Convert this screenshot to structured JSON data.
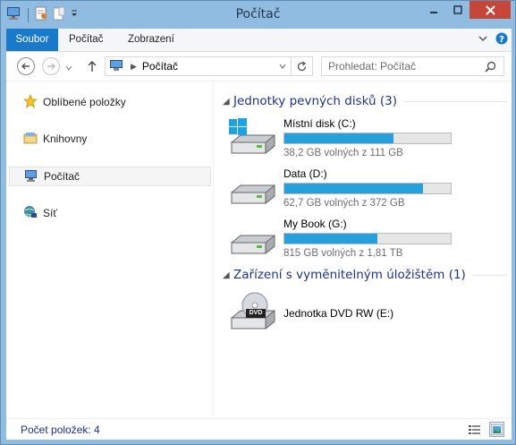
{
  "window": {
    "title": "Počítač"
  },
  "ribbon": {
    "tabs": [
      {
        "label": "Soubor",
        "active": true
      },
      {
        "label": "Počítač",
        "active": false
      },
      {
        "label": "Zobrazení",
        "active": false
      }
    ]
  },
  "address": {
    "path": "Počítač"
  },
  "search": {
    "placeholder": "Prohledat: Počítač"
  },
  "nav": {
    "items": [
      {
        "label": "Oblíbené položky",
        "icon": "star-icon"
      },
      {
        "label": "Knihovny",
        "icon": "library-icon"
      },
      {
        "label": "Počítač",
        "icon": "computer-icon",
        "selected": true
      },
      {
        "label": "Síť",
        "icon": "network-icon"
      }
    ]
  },
  "groups": {
    "hard_drives": {
      "title": "Jednotky pevných disků (3)",
      "drives": [
        {
          "name": "Místní disk (C:)",
          "free": "38,2 GB volných z 111 GB",
          "used_fraction": 0.656,
          "windows": true
        },
        {
          "name": "Data (D:)",
          "free": "62,7 GB volných z 372 GB",
          "used_fraction": 0.831,
          "windows": false
        },
        {
          "name": "My Book (G:)",
          "free": "815 GB volných z 1,81 TB",
          "used_fraction": 0.56,
          "windows": false
        }
      ]
    },
    "removable": {
      "title": "Zařízení s vyměnitelným úložištěm (1)",
      "devices": [
        {
          "name": "Jednotka DVD RW (E:)",
          "icon": "dvd-drive-icon",
          "badge": "DVD"
        }
      ]
    }
  },
  "status": {
    "item_count": "Počet položek: 4"
  },
  "colors": {
    "accent": "#1979ca",
    "bar_fill": "#26a0da",
    "close": "#c7463a",
    "group_title": "#1e3287"
  }
}
